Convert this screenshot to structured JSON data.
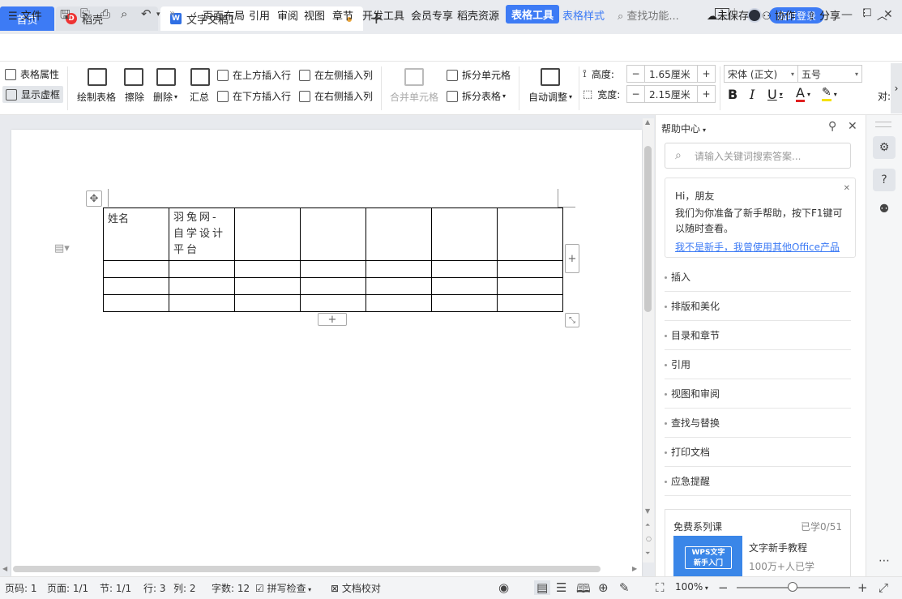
{
  "tabs": {
    "home": "首页",
    "daoke": "稻壳",
    "doc": "文字文稿1",
    "new_tab": "+"
  },
  "window": {
    "login": "临时登录",
    "page_indicator": "1"
  },
  "menu": {
    "file": "文件",
    "items": [
      "页面布局",
      "引用",
      "审阅",
      "视图",
      "章节",
      "开发工具",
      "会员专享",
      "稻壳资源"
    ],
    "table_tools": "表格工具",
    "table_style": "表格样式",
    "search": "查找功能...",
    "unsaved": "未保存",
    "collab": "协作",
    "share": "分享"
  },
  "ribbon": {
    "table_props": "表格属性",
    "show_grid": "显示虚框",
    "draw_table": "绘制表格",
    "erase": "擦除",
    "delete": "删除",
    "summary": "汇总",
    "insert_above": "在上方插入行",
    "insert_below": "在下方插入行",
    "insert_left": "在左侧插入列",
    "insert_right": "在右侧插入列",
    "merge_cells": "合并单元格",
    "split_cells": "拆分单元格",
    "split_table": "拆分表格",
    "auto_adjust": "自动调整",
    "height_label": "高度:",
    "height_value": "1.65厘米",
    "width_label": "宽度:",
    "width_value": "2.15厘米",
    "font_name": "宋体 (正文)",
    "font_size": "五号",
    "bold": "B",
    "italic": "I",
    "underline": "U",
    "font_color": "A",
    "align_partial": "对:"
  },
  "table": {
    "rows": [
      [
        "姓名",
        "羽兔网-自学设计平台",
        "",
        "",
        "",
        "",
        ""
      ],
      [
        "",
        "",
        "",
        "",
        "",
        "",
        ""
      ],
      [
        "",
        "",
        "",
        "",
        "",
        "",
        ""
      ],
      [
        "",
        "",
        "",
        "",
        "",
        "",
        ""
      ]
    ]
  },
  "help": {
    "title": "帮助中心",
    "search_placeholder": "请输入关键词搜索答案...",
    "greeting": "Hi，朋友",
    "intro": "我们为你准备了新手帮助，按下F1键可以随时查看。",
    "link": "我不是新手，我曾使用其他Office产品",
    "items": [
      "插入",
      "排版和美化",
      "目录和章节",
      "引用",
      "视图和审阅",
      "查找与替换",
      "打印文档",
      "应急提醒"
    ],
    "course_title": "免费系列课",
    "course_progress": "已学0/51",
    "course_badge_line1": "WPS文字",
    "course_badge_line2": "新手入门",
    "course_name": "文字新手教程",
    "course_learners": "100万+人已学"
  },
  "status": {
    "page_code": "页码: 1",
    "pages": "页面: 1/1",
    "section": "节: 1/1",
    "row": "行: 3",
    "col": "列: 2",
    "word_count": "字数: 12",
    "spell_check": "拼写检查",
    "doc_proof": "文档校对",
    "zoom": "100%"
  },
  "colors": {
    "accent": "#3d7bf5",
    "tabbar_bg": "#e9ebef",
    "canvas_bg": "#e8eaee"
  }
}
